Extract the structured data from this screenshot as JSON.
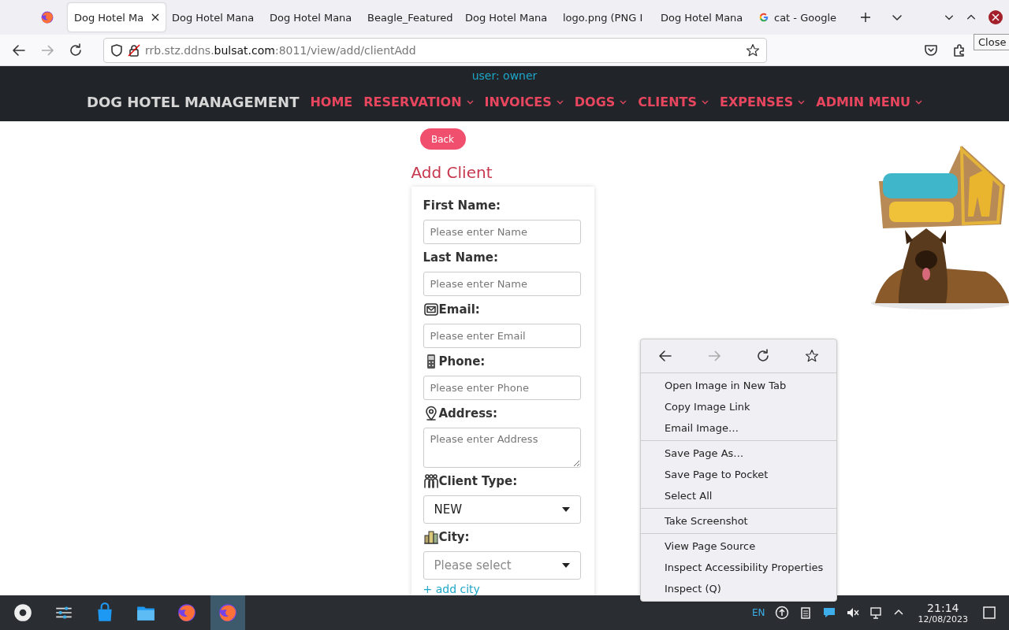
{
  "browser": {
    "tabs": [
      {
        "title": "Dog Hotel Ma",
        "selected": true,
        "closable": true
      },
      {
        "title": "Dog Hotel Mana",
        "selected": false,
        "closable": false
      },
      {
        "title": "Dog Hotel Mana",
        "selected": false,
        "closable": false
      },
      {
        "title": "Beagle_Featured",
        "selected": false,
        "closable": false
      },
      {
        "title": "Dog Hotel Mana",
        "selected": false,
        "closable": false
      },
      {
        "title": "logo.png (PNG I",
        "selected": false,
        "closable": false
      },
      {
        "title": "Dog Hotel Mana",
        "selected": false,
        "closable": false
      },
      {
        "title": "cat - Google",
        "selected": false,
        "closable": false
      }
    ],
    "url": {
      "host_prefix": "rrb.stz.ddns.",
      "host": "bulsat.com",
      "rest": ":8011/view/add/clientAdd"
    },
    "tooltip": "Close"
  },
  "navbar": {
    "user": "user: owner",
    "brand": "DOG HOTEL MANAGEMENT",
    "items": [
      {
        "label": "HOME",
        "dropdown": false
      },
      {
        "label": "RESERVATION",
        "dropdown": true
      },
      {
        "label": "INVOICES",
        "dropdown": true
      },
      {
        "label": "DOGS",
        "dropdown": true
      },
      {
        "label": "CLIENTS",
        "dropdown": true
      },
      {
        "label": "EXPENSES",
        "dropdown": true
      },
      {
        "label": "ADMIN MENU",
        "dropdown": true
      }
    ]
  },
  "back_button": "Back",
  "form": {
    "title": "Add Client",
    "fields": [
      {
        "label": "First Name:",
        "kind": "input",
        "placeholder": "Please enter Name"
      },
      {
        "label": "Last Name:",
        "kind": "input",
        "placeholder": "Please enter Name"
      },
      {
        "label": "Email:",
        "kind": "input",
        "placeholder": "Please enter Email"
      },
      {
        "label": "Phone:",
        "kind": "input",
        "placeholder": "Please enter Phone"
      },
      {
        "label": "Address:",
        "kind": "textarea",
        "placeholder": "Please enter Address"
      },
      {
        "label": "Client Type:",
        "kind": "select",
        "value": "NEW"
      },
      {
        "label": "City:",
        "kind": "select",
        "placeholder": "Please select"
      }
    ],
    "add_link": "+ add city"
  },
  "context_menu": {
    "groups": [
      [
        "Open Image in New Tab",
        "Copy Image Link",
        "Email Image…"
      ],
      [
        "Save Page As…",
        "Save Page to Pocket",
        "Select All"
      ],
      [
        "Take Screenshot"
      ],
      [
        "View Page Source",
        "Inspect Accessibility Properties",
        "Inspect (Q)"
      ]
    ]
  },
  "taskbar": {
    "apps": [
      {
        "kind": "launcher",
        "selected": false
      },
      {
        "kind": "settings",
        "selected": false
      },
      {
        "kind": "store",
        "selected": false
      },
      {
        "kind": "files",
        "selected": false
      },
      {
        "kind": "firefox",
        "selected": false
      },
      {
        "kind": "firefox",
        "selected": true
      }
    ],
    "language": "EN",
    "time": "21:14",
    "date": "12/08/2023"
  }
}
